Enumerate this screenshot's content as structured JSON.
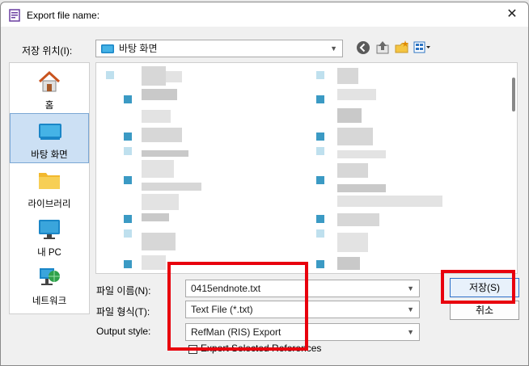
{
  "dialog": {
    "title": "Export file name:",
    "close_glyph": "✕"
  },
  "location": {
    "label": "저장 위치(I):",
    "value": "바탕 화면"
  },
  "places": [
    {
      "label": "홈",
      "icon": "home-icon"
    },
    {
      "label": "바탕 화면",
      "icon": "desktop-icon"
    },
    {
      "label": "라이브러리",
      "icon": "folder-icon"
    },
    {
      "label": "내 PC",
      "icon": "pc-icon"
    },
    {
      "label": "네트워크",
      "icon": "network-icon"
    }
  ],
  "filename": {
    "label": "파일 이름(N):",
    "value": "0415endnote.txt"
  },
  "filetype": {
    "label": "파일 형식(T):",
    "value": "Text File (*.txt)"
  },
  "output_style": {
    "label": "Output style:",
    "value": "RefMan (RIS) Export"
  },
  "export_selected": {
    "label": "Export Selected References"
  },
  "buttons": {
    "save": "저장(S)",
    "cancel": "취소"
  },
  "colors": {
    "highlight": "#e8000d",
    "selection": "#cce0f4",
    "accent": "#2a6fc9"
  }
}
